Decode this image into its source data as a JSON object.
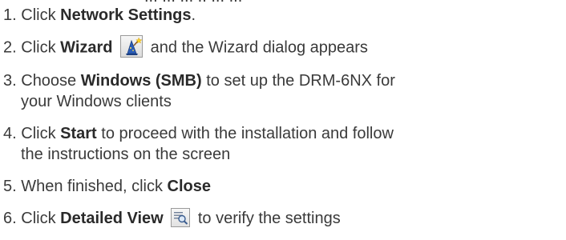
{
  "partial_top_line": "... ... ... .. ... ...",
  "steps": [
    {
      "num": "1.",
      "pre": "Click ",
      "bold": "Network Settings",
      "post": "."
    },
    {
      "num": "2.",
      "pre": "Click ",
      "bold": "Wizard",
      "post": " and the Wizard dialog appears",
      "icon": "wizard-icon"
    },
    {
      "num": "3.",
      "pre": " Choose ",
      "bold": "Windows (SMB)",
      "post": " to set up the DRM-6NX  for",
      "cont": "your Windows clients"
    },
    {
      "num": "4.",
      "pre": "Click ",
      "bold": "Start",
      "post": " to proceed with the installation and follow",
      "cont": "the instructions on the screen"
    },
    {
      "num": "5.",
      "pre": "When finished, click ",
      "bold": "Close",
      "post": ""
    },
    {
      "num": "6.",
      "pre": "Click ",
      "bold": "Detailed View",
      "post": " to verify the settings",
      "icon": "detailed-view-icon"
    }
  ]
}
